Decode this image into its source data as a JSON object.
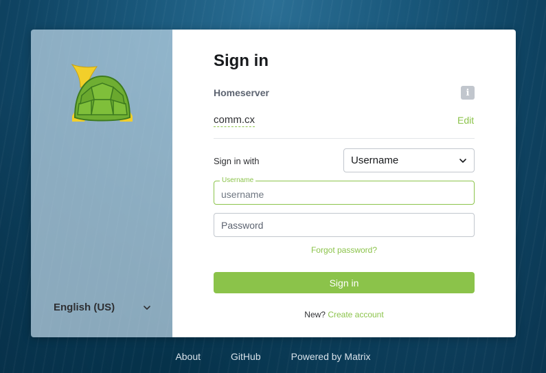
{
  "branding": {
    "logo_icon": "turtle-with-horn-icon",
    "colors": {
      "accent": "#8bc34a",
      "shell_dark": "#3d7a1f",
      "shell_light": "#7fbf3a",
      "horn": "#f2cf2a"
    }
  },
  "language": {
    "selected": "English (US)",
    "chevron_icon": "chevron-down-icon"
  },
  "form": {
    "title": "Sign in",
    "homeserver_label": "Homeserver",
    "info_icon": "info-icon",
    "info_glyph": "i",
    "homeserver_value": "comm.cx",
    "edit_label": "Edit",
    "sign_in_with_label": "Sign in with",
    "sign_in_with_selected": "Username",
    "username_float_label": "Username",
    "username_placeholder": "username",
    "username_value": "",
    "password_placeholder": "Password",
    "password_value": "",
    "forgot_label": "Forgot password?",
    "submit_label": "Sign in",
    "new_prefix": "New?",
    "create_account_label": "Create account"
  },
  "footer": {
    "links": [
      "About",
      "GitHub",
      "Powered by Matrix"
    ]
  }
}
